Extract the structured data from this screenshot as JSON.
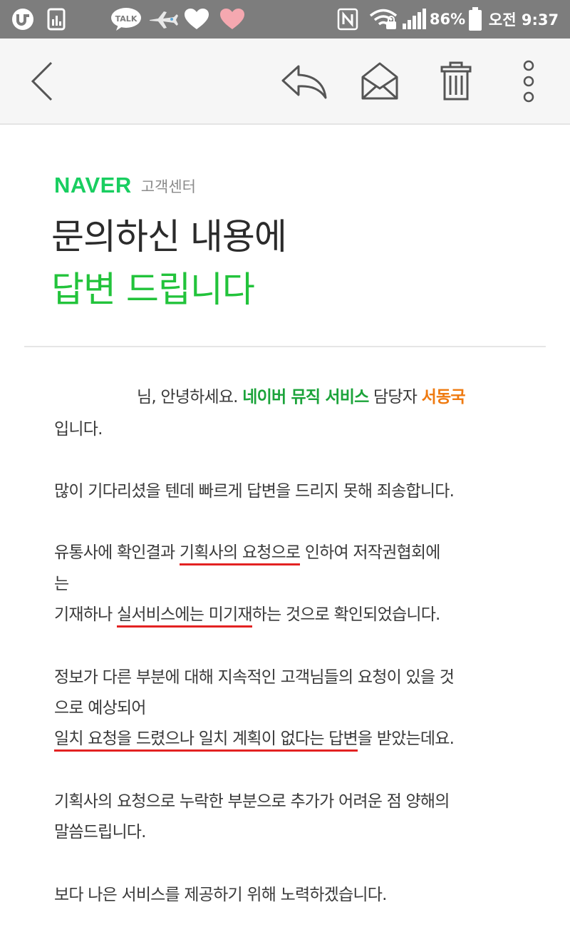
{
  "status_bar": {
    "battery": "86%",
    "time": "오전 9:37",
    "talk_label": "TALK",
    "icons": [
      "u-plus-icon",
      "chart-app-icon",
      "kakaotalk-icon",
      "airplane-icon",
      "heart-white-icon",
      "heart-pink-icon",
      "nfc-icon",
      "wifi-icon",
      "signal-icon",
      "battery-icon"
    ]
  },
  "toolbar": {
    "icons": [
      "back-icon",
      "reply-icon",
      "mail-open-icon",
      "trash-icon",
      "more-icon"
    ]
  },
  "email": {
    "brand": "NAVER",
    "brand_sub": "고객센터",
    "headline_1": "문의하신 내용에",
    "headline_2": "답변 드립니다",
    "greeting": {
      "pre": "님, 안녕하세요. ",
      "service": "네이버 뮤직 서비스",
      "mid": " 담당자 ",
      "agent": "서동국",
      "end": "입니다."
    },
    "p1": "많이 기다리셨을 텐데 빠르게 답변을 드리지 못해 죄송합니다.",
    "p2": {
      "a": "유통사에 확인결과 ",
      "b": "기획사의 요청으로",
      "c": " 인하여 저작권협회에",
      "d": "는",
      "e": "기재하나 ",
      "f": "실서비스에는 미기재",
      "g": "하는 것으로 확인되었습니다."
    },
    "p3": {
      "a": "정보가 다른 부분에 대해 지속적인 고객님들의 요청이 있을 것",
      "b": "으로 예상되어",
      "c": "일치 요청을 드렸으나 일치 계획이 없다는 답변",
      "d": "을 받았는데요."
    },
    "p4": {
      "a": "기획사의 요청으로 누락한 부분으로 추가가 어려운 점 양해의",
      "b": "말씀드립니다."
    },
    "p5": "보다 나은 서비스를 제공하기 위해 노력하겠습니다.",
    "colors": {
      "brand": "#19ce60",
      "headline_green": "#22c33b",
      "service": "#1ba33a",
      "agent": "#ef7a10",
      "underline": "#e32222"
    }
  }
}
